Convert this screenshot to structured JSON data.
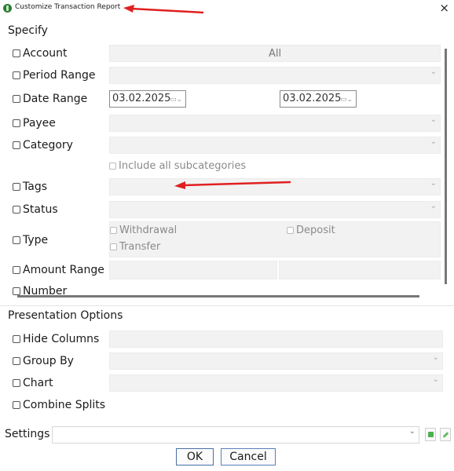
{
  "window": {
    "title": "Customize Transaction Report",
    "close_glyph": "×",
    "icon": "money-icon"
  },
  "specify": {
    "section_title": "Specify",
    "account": {
      "label": "Account",
      "value": "All"
    },
    "period_range": {
      "label": "Period Range"
    },
    "date_range": {
      "label": "Date Range",
      "from": "03.02.2025",
      "to": "03.02.2025"
    },
    "payee": {
      "label": "Payee"
    },
    "category": {
      "label": "Category",
      "include_sub": "Include all subcategories"
    },
    "tags": {
      "label": "Tags"
    },
    "status": {
      "label": "Status"
    },
    "type": {
      "label": "Type",
      "withdrawal": "Withdrawal",
      "deposit": "Deposit",
      "transfer": "Transfer"
    },
    "amount_range": {
      "label": "Amount Range"
    },
    "number": {
      "label": "Number"
    }
  },
  "presentation": {
    "section_title": "Presentation Options",
    "hide_columns": "Hide Columns",
    "group_by": "Group By",
    "chart": "Chart",
    "combine_splits": "Combine Splits"
  },
  "footer": {
    "settings_label": "Settings",
    "ok": "OK",
    "cancel": "Cancel"
  },
  "colors": {
    "annotation_arrow": "#e02020",
    "ok_border": "#4a6fa5"
  }
}
